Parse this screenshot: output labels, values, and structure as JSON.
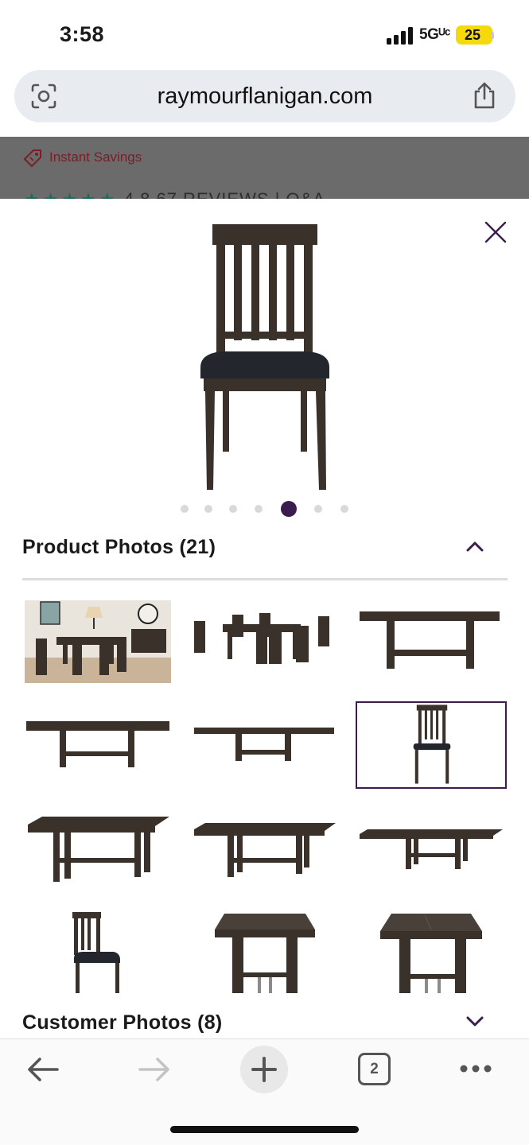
{
  "status_bar": {
    "time": "3:58",
    "network": "5Gᵁᶜ",
    "battery": "25"
  },
  "browser": {
    "url": "raymourflanigan.com",
    "lens_icon": "lens-icon",
    "share_icon": "share-icon"
  },
  "background_page": {
    "savings_label": "Instant Savings",
    "stars": "★★★★★",
    "rating": "4.8",
    "reviews": "67 REVIEWS",
    "separator": "|",
    "qa": "Q&A",
    "colors": {
      "savings": "#7a1d27",
      "stars": "#1a6b5e"
    }
  },
  "gallery_modal": {
    "close_icon": "close-icon",
    "carousel": {
      "dot_count": 7,
      "active_index": 4
    },
    "product_photos": {
      "title": "Product Photos (21)",
      "expanded": true
    },
    "customer_photos": {
      "title": "Customer Photos (8)",
      "expanded": false
    },
    "selected_thumbnail_index": 5,
    "thumbnails": [
      "room-scene-photo",
      "dining-set-photo",
      "extended-table-photo",
      "table-photo",
      "table-leaf-photo",
      "side-chair-photo",
      "table-angle-photo",
      "table-front-photo",
      "table-long-photo",
      "chair-detail-photo",
      "table-top-photo",
      "table-top-angle-photo"
    ],
    "colors": {
      "accent": "#3a1d4f",
      "wood": "#3a312b",
      "seat": "#23262c"
    }
  },
  "toolbar": {
    "back_icon": "arrow-left-icon",
    "forward_icon": "arrow-right-icon",
    "new_tab_icon": "plus-icon",
    "tab_count": "2",
    "more_icon": "more-icon"
  }
}
